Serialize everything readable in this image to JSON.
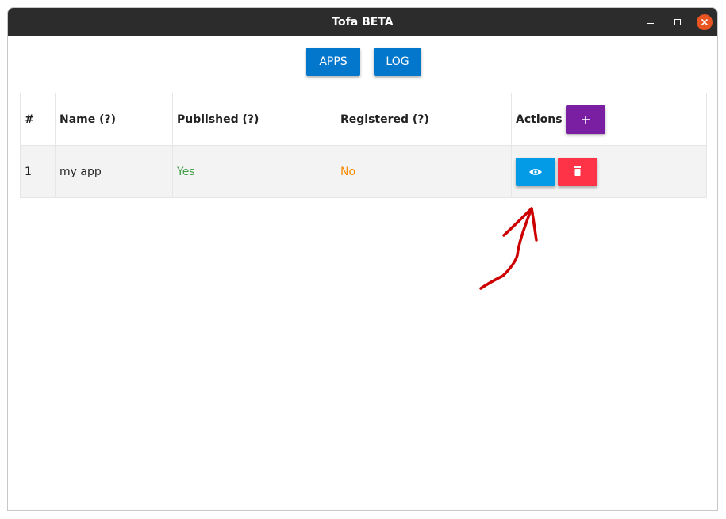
{
  "window": {
    "title": "Tofa BETA",
    "controls": [
      "minimize-icon",
      "maximize-icon",
      "close-icon"
    ],
    "close_color": "#e95420",
    "titlebar_color": "#2c2c2c"
  },
  "nav": {
    "apps_label": "APPS",
    "log_label": "LOG",
    "button_color": "#0277cc"
  },
  "table": {
    "headers": {
      "num": "#",
      "name": "Name (?)",
      "published": "Published (?)",
      "registered": "Registered (?)",
      "actions": "Actions"
    },
    "add_button": {
      "icon": "plus-icon",
      "color": "#7b1fa2"
    },
    "rows": [
      {
        "num": "1",
        "name": "my app",
        "published": "Yes",
        "registered": "No",
        "view_button": {
          "icon": "eye-icon",
          "color": "#039be5"
        },
        "delete_button": {
          "icon": "trash-icon",
          "color": "#ff3347"
        }
      }
    ],
    "status_colors": {
      "yes": "#43a047",
      "no": "#fb8c00"
    }
  },
  "annotation": {
    "icon": "arrow-annotation",
    "color": "#cc0000"
  }
}
